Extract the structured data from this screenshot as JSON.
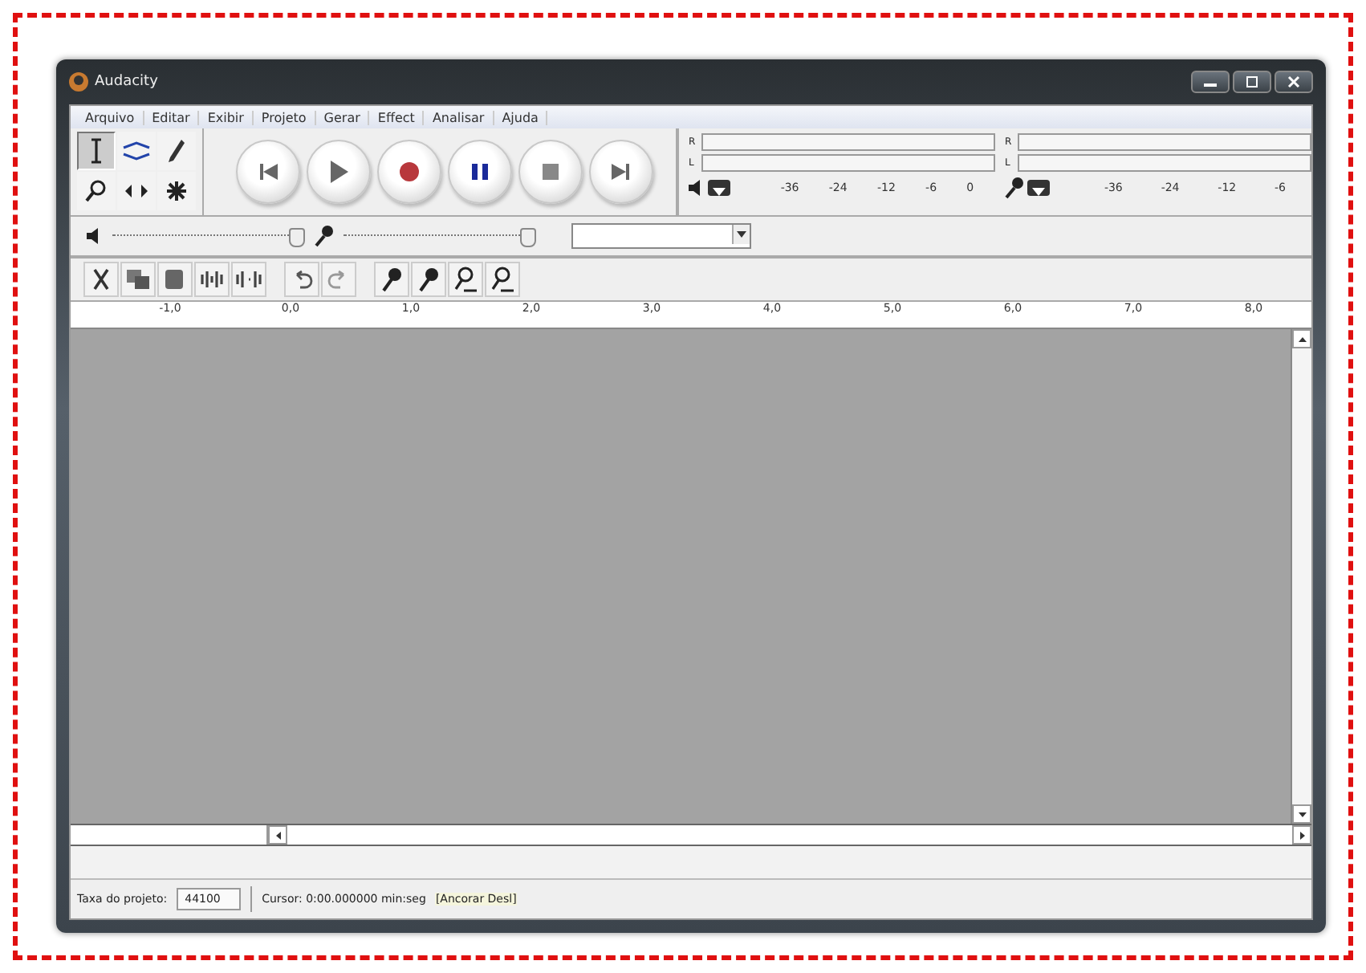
{
  "window": {
    "title": "Audacity"
  },
  "menu": [
    "Arquivo",
    "Editar",
    "Exibir",
    "Projeto",
    "Gerar",
    "Effect",
    "Analisar",
    "Ajuda"
  ],
  "tools": [
    {
      "kind": "ibeam",
      "selected": true
    },
    {
      "kind": "envelope",
      "selected": false
    },
    {
      "kind": "pencil",
      "selected": false
    },
    {
      "kind": "zoom",
      "selected": false
    },
    {
      "kind": "timeshift",
      "selected": false
    },
    {
      "kind": "multi",
      "selected": false
    }
  ],
  "transport": [
    {
      "kind": "start"
    },
    {
      "kind": "play"
    },
    {
      "kind": "record"
    },
    {
      "kind": "pause"
    },
    {
      "kind": "stop"
    },
    {
      "kind": "end"
    }
  ],
  "meters": [
    {
      "kind": "playback",
      "channels": [
        "R",
        "L"
      ],
      "ticks": [
        "-36",
        "-24",
        "-12",
        "-6",
        "0"
      ]
    },
    {
      "kind": "record",
      "channels": [
        "R",
        "L"
      ],
      "ticks": [
        "-36",
        "-24",
        "-12",
        "-6"
      ]
    }
  ],
  "mixer": [
    {
      "kind": "output",
      "level": 0.95
    },
    {
      "kind": "input",
      "level": 0.95
    }
  ],
  "edit_tools": [
    {
      "kind": "trim"
    },
    {
      "kind": "copy"
    },
    {
      "kind": "paste"
    },
    {
      "kind": "trimaudio"
    },
    {
      "kind": "silence"
    },
    {
      "kind": "undo"
    },
    {
      "kind": "redo"
    },
    {
      "kind": "mic"
    },
    {
      "kind": "mic"
    },
    {
      "kind": "micline"
    },
    {
      "kind": "micline"
    }
  ],
  "ruler": [
    "-1,0",
    "0,0",
    "1,0",
    "2,0",
    "3,0",
    "4,0",
    "5,0",
    "6,0",
    "7,0",
    "8,0"
  ],
  "status_bar": {
    "rate_label": "Taxa do projeto:",
    "rate": "44100",
    "cursor": "Cursor: 0:00.000000 min:seg",
    "snap": "[Ancorar Desl]"
  }
}
